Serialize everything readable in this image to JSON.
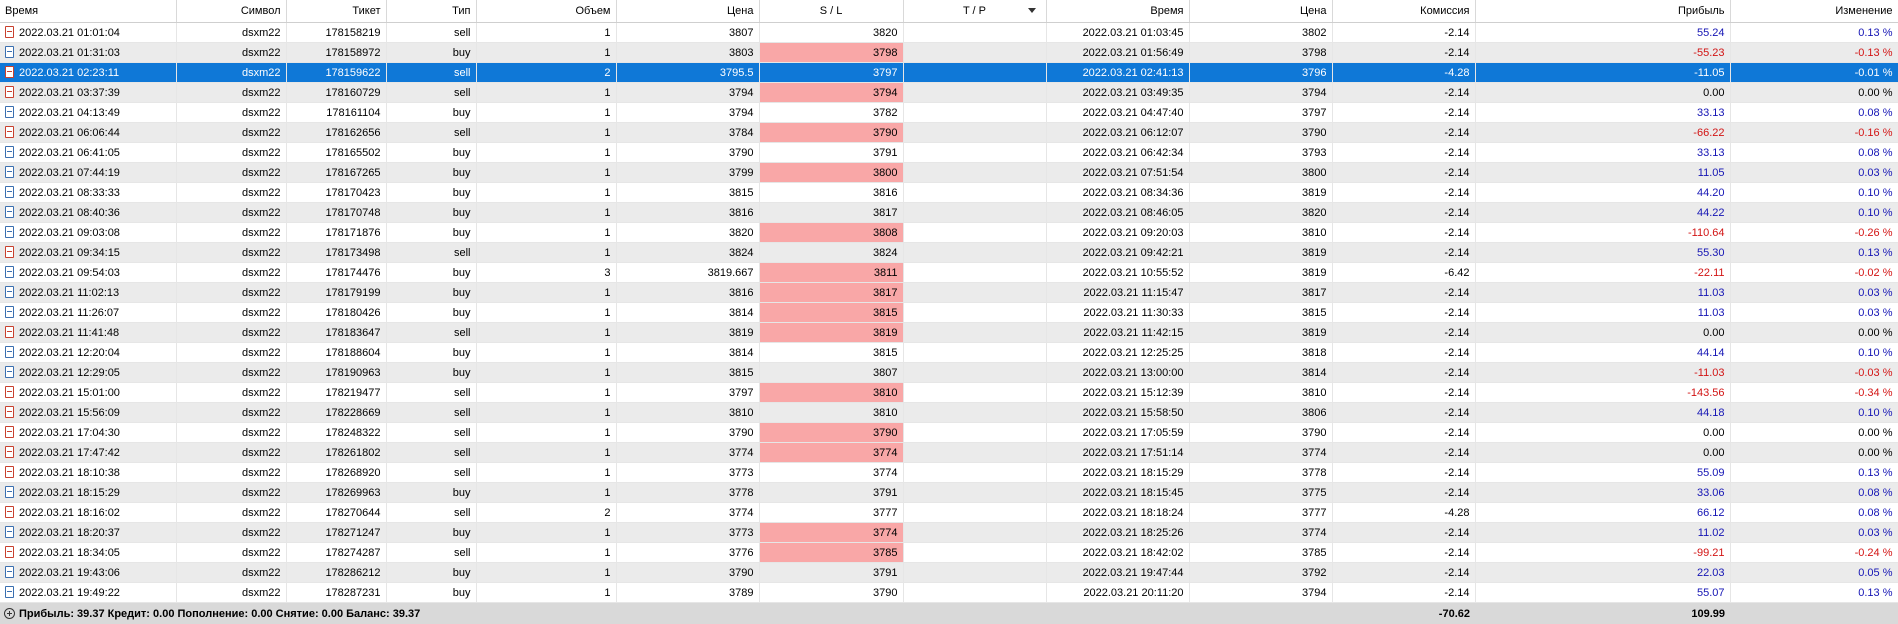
{
  "columns": {
    "time": "Время",
    "symbol": "Символ",
    "ticket": "Тикет",
    "type": "Тип",
    "volume": "Объем",
    "price": "Цена",
    "sl": "S / L",
    "tp": "T / P",
    "close_time": "Время",
    "close_price": "Цена",
    "commission": "Комиссия",
    "profit": "Прибыль",
    "change": "Изменение"
  },
  "sort_column": "tp",
  "colors": {
    "selected_row": "#0f78d7",
    "sl_highlight": "#f9a7a7",
    "positive": "#1414b4",
    "negative": "#d21414",
    "footer": "#d9d9d9"
  },
  "rows": [
    {
      "time": "2022.03.21 01:01:04",
      "symbol": "dsxm22",
      "ticket": "178158219",
      "type": "sell",
      "volume": "1",
      "price": "3807",
      "sl": "3820",
      "tp": "",
      "close_time": "2022.03.21 01:03:45",
      "close_price": "3802",
      "commission": "-2.14",
      "profit": "55.24",
      "change": "0.13 %",
      "icon": "sell-order-icon",
      "sl_highlight": false,
      "selected": false,
      "sign": "pos"
    },
    {
      "time": "2022.03.21 01:31:03",
      "symbol": "dsxm22",
      "ticket": "178158972",
      "type": "buy",
      "volume": "1",
      "price": "3803",
      "sl": "3798",
      "tp": "",
      "close_time": "2022.03.21 01:56:49",
      "close_price": "3798",
      "commission": "-2.14",
      "profit": "-55.23",
      "change": "-0.13 %",
      "icon": "buy-order-icon",
      "sl_highlight": true,
      "selected": false,
      "sign": "neg"
    },
    {
      "time": "2022.03.21 02:23:11",
      "symbol": "dsxm22",
      "ticket": "178159622",
      "type": "sell",
      "volume": "2",
      "price": "3795.5",
      "sl": "3797",
      "tp": "",
      "close_time": "2022.03.21 02:41:13",
      "close_price": "3796",
      "commission": "-4.28",
      "profit": "-11.05",
      "change": "-0.01 %",
      "icon": "sell-order-icon",
      "sl_highlight": false,
      "selected": true,
      "sign": "neg"
    },
    {
      "time": "2022.03.21 03:37:39",
      "symbol": "dsxm22",
      "ticket": "178160729",
      "type": "sell",
      "volume": "1",
      "price": "3794",
      "sl": "3794",
      "tp": "",
      "close_time": "2022.03.21 03:49:35",
      "close_price": "3794",
      "commission": "-2.14",
      "profit": "0.00",
      "change": "0.00 %",
      "icon": "sell-order-icon",
      "sl_highlight": true,
      "selected": false,
      "sign": "zero"
    },
    {
      "time": "2022.03.21 04:13:49",
      "symbol": "dsxm22",
      "ticket": "178161104",
      "type": "buy",
      "volume": "1",
      "price": "3794",
      "sl": "3782",
      "tp": "",
      "close_time": "2022.03.21 04:47:40",
      "close_price": "3797",
      "commission": "-2.14",
      "profit": "33.13",
      "change": "0.08 %",
      "icon": "buy-order-icon",
      "sl_highlight": false,
      "selected": false,
      "sign": "pos"
    },
    {
      "time": "2022.03.21 06:06:44",
      "symbol": "dsxm22",
      "ticket": "178162656",
      "type": "sell",
      "volume": "1",
      "price": "3784",
      "sl": "3790",
      "tp": "",
      "close_time": "2022.03.21 06:12:07",
      "close_price": "3790",
      "commission": "-2.14",
      "profit": "-66.22",
      "change": "-0.16 %",
      "icon": "sell-order-icon",
      "sl_highlight": true,
      "selected": false,
      "sign": "neg"
    },
    {
      "time": "2022.03.21 06:41:05",
      "symbol": "dsxm22",
      "ticket": "178165502",
      "type": "buy",
      "volume": "1",
      "price": "3790",
      "sl": "3791",
      "tp": "",
      "close_time": "2022.03.21 06:42:34",
      "close_price": "3793",
      "commission": "-2.14",
      "profit": "33.13",
      "change": "0.08 %",
      "icon": "buy-order-icon",
      "sl_highlight": false,
      "selected": false,
      "sign": "pos"
    },
    {
      "time": "2022.03.21 07:44:19",
      "symbol": "dsxm22",
      "ticket": "178167265",
      "type": "buy",
      "volume": "1",
      "price": "3799",
      "sl": "3800",
      "tp": "",
      "close_time": "2022.03.21 07:51:54",
      "close_price": "3800",
      "commission": "-2.14",
      "profit": "11.05",
      "change": "0.03 %",
      "icon": "buy-order-icon",
      "sl_highlight": true,
      "selected": false,
      "sign": "pos"
    },
    {
      "time": "2022.03.21 08:33:33",
      "symbol": "dsxm22",
      "ticket": "178170423",
      "type": "buy",
      "volume": "1",
      "price": "3815",
      "sl": "3816",
      "tp": "",
      "close_time": "2022.03.21 08:34:36",
      "close_price": "3819",
      "commission": "-2.14",
      "profit": "44.20",
      "change": "0.10 %",
      "icon": "buy-order-icon",
      "sl_highlight": false,
      "selected": false,
      "sign": "pos"
    },
    {
      "time": "2022.03.21 08:40:36",
      "symbol": "dsxm22",
      "ticket": "178170748",
      "type": "buy",
      "volume": "1",
      "price": "3816",
      "sl": "3817",
      "tp": "",
      "close_time": "2022.03.21 08:46:05",
      "close_price": "3820",
      "commission": "-2.14",
      "profit": "44.22",
      "change": "0.10 %",
      "icon": "buy-order-icon",
      "sl_highlight": false,
      "selected": false,
      "sign": "pos"
    },
    {
      "time": "2022.03.21 09:03:08",
      "symbol": "dsxm22",
      "ticket": "178171876",
      "type": "buy",
      "volume": "1",
      "price": "3820",
      "sl": "3808",
      "tp": "",
      "close_time": "2022.03.21 09:20:03",
      "close_price": "3810",
      "commission": "-2.14",
      "profit": "-110.64",
      "change": "-0.26 %",
      "icon": "buy-order-icon",
      "sl_highlight": true,
      "selected": false,
      "sign": "neg"
    },
    {
      "time": "2022.03.21 09:34:15",
      "symbol": "dsxm22",
      "ticket": "178173498",
      "type": "sell",
      "volume": "1",
      "price": "3824",
      "sl": "3824",
      "tp": "",
      "close_time": "2022.03.21 09:42:21",
      "close_price": "3819",
      "commission": "-2.14",
      "profit": "55.30",
      "change": "0.13 %",
      "icon": "sell-order-icon",
      "sl_highlight": false,
      "selected": false,
      "sign": "pos"
    },
    {
      "time": "2022.03.21 09:54:03",
      "symbol": "dsxm22",
      "ticket": "178174476",
      "type": "buy",
      "volume": "3",
      "price": "3819.667",
      "sl": "3811",
      "tp": "",
      "close_time": "2022.03.21 10:55:52",
      "close_price": "3819",
      "commission": "-6.42",
      "profit": "-22.11",
      "change": "-0.02 %",
      "icon": "buy-order-icon",
      "sl_highlight": true,
      "selected": false,
      "sign": "neg"
    },
    {
      "time": "2022.03.21 11:02:13",
      "symbol": "dsxm22",
      "ticket": "178179199",
      "type": "buy",
      "volume": "1",
      "price": "3816",
      "sl": "3817",
      "tp": "",
      "close_time": "2022.03.21 11:15:47",
      "close_price": "3817",
      "commission": "-2.14",
      "profit": "11.03",
      "change": "0.03 %",
      "icon": "buy-order-icon",
      "sl_highlight": true,
      "selected": false,
      "sign": "pos"
    },
    {
      "time": "2022.03.21 11:26:07",
      "symbol": "dsxm22",
      "ticket": "178180426",
      "type": "buy",
      "volume": "1",
      "price": "3814",
      "sl": "3815",
      "tp": "",
      "close_time": "2022.03.21 11:30:33",
      "close_price": "3815",
      "commission": "-2.14",
      "profit": "11.03",
      "change": "0.03 %",
      "icon": "buy-order-icon",
      "sl_highlight": true,
      "selected": false,
      "sign": "pos"
    },
    {
      "time": "2022.03.21 11:41:48",
      "symbol": "dsxm22",
      "ticket": "178183647",
      "type": "sell",
      "volume": "1",
      "price": "3819",
      "sl": "3819",
      "tp": "",
      "close_time": "2022.03.21 11:42:15",
      "close_price": "3819",
      "commission": "-2.14",
      "profit": "0.00",
      "change": "0.00 %",
      "icon": "sell-order-icon",
      "sl_highlight": true,
      "selected": false,
      "sign": "zero"
    },
    {
      "time": "2022.03.21 12:20:04",
      "symbol": "dsxm22",
      "ticket": "178188604",
      "type": "buy",
      "volume": "1",
      "price": "3814",
      "sl": "3815",
      "tp": "",
      "close_time": "2022.03.21 12:25:25",
      "close_price": "3818",
      "commission": "-2.14",
      "profit": "44.14",
      "change": "0.10 %",
      "icon": "buy-order-icon",
      "sl_highlight": false,
      "selected": false,
      "sign": "pos"
    },
    {
      "time": "2022.03.21 12:29:05",
      "symbol": "dsxm22",
      "ticket": "178190963",
      "type": "buy",
      "volume": "1",
      "price": "3815",
      "sl": "3807",
      "tp": "",
      "close_time": "2022.03.21 13:00:00",
      "close_price": "3814",
      "commission": "-2.14",
      "profit": "-11.03",
      "change": "-0.03 %",
      "icon": "buy-order-icon",
      "sl_highlight": false,
      "selected": false,
      "sign": "neg"
    },
    {
      "time": "2022.03.21 15:01:00",
      "symbol": "dsxm22",
      "ticket": "178219477",
      "type": "sell",
      "volume": "1",
      "price": "3797",
      "sl": "3810",
      "tp": "",
      "close_time": "2022.03.21 15:12:39",
      "close_price": "3810",
      "commission": "-2.14",
      "profit": "-143.56",
      "change": "-0.34 %",
      "icon": "sell-order-icon",
      "sl_highlight": true,
      "selected": false,
      "sign": "neg"
    },
    {
      "time": "2022.03.21 15:56:09",
      "symbol": "dsxm22",
      "ticket": "178228669",
      "type": "sell",
      "volume": "1",
      "price": "3810",
      "sl": "3810",
      "tp": "",
      "close_time": "2022.03.21 15:58:50",
      "close_price": "3806",
      "commission": "-2.14",
      "profit": "44.18",
      "change": "0.10 %",
      "icon": "sell-order-icon",
      "sl_highlight": false,
      "selected": false,
      "sign": "pos"
    },
    {
      "time": "2022.03.21 17:04:30",
      "symbol": "dsxm22",
      "ticket": "178248322",
      "type": "sell",
      "volume": "1",
      "price": "3790",
      "sl": "3790",
      "tp": "",
      "close_time": "2022.03.21 17:05:59",
      "close_price": "3790",
      "commission": "-2.14",
      "profit": "0.00",
      "change": "0.00 %",
      "icon": "sell-order-icon",
      "sl_highlight": true,
      "selected": false,
      "sign": "zero"
    },
    {
      "time": "2022.03.21 17:47:42",
      "symbol": "dsxm22",
      "ticket": "178261802",
      "type": "sell",
      "volume": "1",
      "price": "3774",
      "sl": "3774",
      "tp": "",
      "close_time": "2022.03.21 17:51:14",
      "close_price": "3774",
      "commission": "-2.14",
      "profit": "0.00",
      "change": "0.00 %",
      "icon": "sell-order-icon",
      "sl_highlight": true,
      "selected": false,
      "sign": "zero"
    },
    {
      "time": "2022.03.21 18:10:38",
      "symbol": "dsxm22",
      "ticket": "178268920",
      "type": "sell",
      "volume": "1",
      "price": "3773",
      "sl": "3774",
      "tp": "",
      "close_time": "2022.03.21 18:15:29",
      "close_price": "3778",
      "commission": "-2.14",
      "profit": "55.09",
      "change": "0.13 %",
      "icon": "sell-order-icon",
      "sl_highlight": false,
      "selected": false,
      "sign": "pos"
    },
    {
      "time": "2022.03.21 18:15:29",
      "symbol": "dsxm22",
      "ticket": "178269963",
      "type": "buy",
      "volume": "1",
      "price": "3778",
      "sl": "3791",
      "tp": "",
      "close_time": "2022.03.21 18:15:45",
      "close_price": "3775",
      "commission": "-2.14",
      "profit": "33.06",
      "change": "0.08 %",
      "icon": "buy-order-icon",
      "sl_highlight": false,
      "selected": false,
      "sign": "pos"
    },
    {
      "time": "2022.03.21 18:16:02",
      "symbol": "dsxm22",
      "ticket": "178270644",
      "type": "sell",
      "volume": "2",
      "price": "3774",
      "sl": "3777",
      "tp": "",
      "close_time": "2022.03.21 18:18:24",
      "close_price": "3777",
      "commission": "-4.28",
      "profit": "66.12",
      "change": "0.08 %",
      "icon": "sell-order-icon",
      "sl_highlight": false,
      "selected": false,
      "sign": "pos"
    },
    {
      "time": "2022.03.21 18:20:37",
      "symbol": "dsxm22",
      "ticket": "178271247",
      "type": "buy",
      "volume": "1",
      "price": "3773",
      "sl": "3774",
      "tp": "",
      "close_time": "2022.03.21 18:25:26",
      "close_price": "3774",
      "commission": "-2.14",
      "profit": "11.02",
      "change": "0.03 %",
      "icon": "buy-order-icon",
      "sl_highlight": true,
      "selected": false,
      "sign": "pos"
    },
    {
      "time": "2022.03.21 18:34:05",
      "symbol": "dsxm22",
      "ticket": "178274287",
      "type": "sell",
      "volume": "1",
      "price": "3776",
      "sl": "3785",
      "tp": "",
      "close_time": "2022.03.21 18:42:02",
      "close_price": "3785",
      "commission": "-2.14",
      "profit": "-99.21",
      "change": "-0.24 %",
      "icon": "sell-order-icon",
      "sl_highlight": true,
      "selected": false,
      "sign": "neg"
    },
    {
      "time": "2022.03.21 19:43:06",
      "symbol": "dsxm22",
      "ticket": "178286212",
      "type": "buy",
      "volume": "1",
      "price": "3790",
      "sl": "3791",
      "tp": "",
      "close_time": "2022.03.21 19:47:44",
      "close_price": "3792",
      "commission": "-2.14",
      "profit": "22.03",
      "change": "0.05 %",
      "icon": "buy-order-icon",
      "sl_highlight": false,
      "selected": false,
      "sign": "pos"
    },
    {
      "time": "2022.03.21 19:49:22",
      "symbol": "dsxm22",
      "ticket": "178287231",
      "type": "buy",
      "volume": "1",
      "price": "3789",
      "sl": "3790",
      "tp": "",
      "close_time": "2022.03.21 20:11:20",
      "close_price": "3794",
      "commission": "-2.14",
      "profit": "55.07",
      "change": "0.13 %",
      "icon": "buy-order-icon",
      "sl_highlight": false,
      "selected": false,
      "sign": "pos"
    }
  ],
  "summary": {
    "icon": "expand-plus-icon",
    "text": "Прибыль: 39.37  Кредит: 0.00  Пополнение: 0.00  Снятие: 0.00  Баланс: 39.37",
    "commission_total": "-70.62",
    "profit_total": "109.99"
  }
}
